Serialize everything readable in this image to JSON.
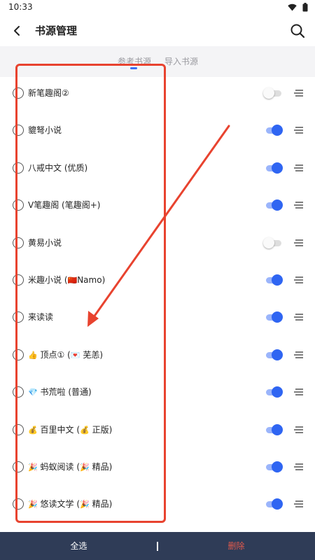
{
  "status_bar": {
    "time": "10:33"
  },
  "app_bar": {
    "title": "书源管理"
  },
  "tabs": [
    {
      "label": "参考书源",
      "active": true
    },
    {
      "label": "导入书源",
      "active": false
    }
  ],
  "sources": [
    {
      "name": "新笔趣阁②",
      "enabled": false
    },
    {
      "name": "貔弩小说",
      "enabled": true
    },
    {
      "name": "八戒中文 (优质)",
      "enabled": true
    },
    {
      "name": "V笔趣阁 (笔趣阁+)",
      "enabled": true
    },
    {
      "name": "黄易小说",
      "enabled": false
    },
    {
      "name": "米趣小说 (",
      "flag": "🇨🇳",
      "name_suffix": "Namo)",
      "enabled": true
    },
    {
      "name": "来读读",
      "enabled": true
    },
    {
      "prefix_icon": "👍",
      "name": "顶点① (",
      "inner_icon": "💌",
      "name_suffix": "芜恙)",
      "enabled": true
    },
    {
      "prefix_icon": "💎",
      "name": "书荒啦 (普通)",
      "enabled": true
    },
    {
      "prefix_icon": "💰",
      "name": "百里中文 (",
      "inner_icon": "💰",
      "name_suffix": "正版)",
      "enabled": true
    },
    {
      "prefix_icon": "🎉",
      "name": "蚂蚁阅读 (",
      "inner_icon": "🎉",
      "name_suffix": "精品)",
      "enabled": true
    },
    {
      "prefix_icon": "🎉",
      "name": "悠读文学 (",
      "inner_icon": "🎉",
      "name_suffix": "精品)",
      "enabled": true
    }
  ],
  "bottom_bar": {
    "select_all": "全选",
    "delete": "删除"
  },
  "colors": {
    "accent": "#2f65f2",
    "bottom_bar_bg": "#2f3c57",
    "delete_text": "#e0594c",
    "annotation": "#e8432f"
  },
  "icons": {
    "back": "chevron-left-icon",
    "search": "search-icon",
    "drag": "drag-handle-icon",
    "wifi": "wifi-icon",
    "battery": "battery-icon"
  }
}
